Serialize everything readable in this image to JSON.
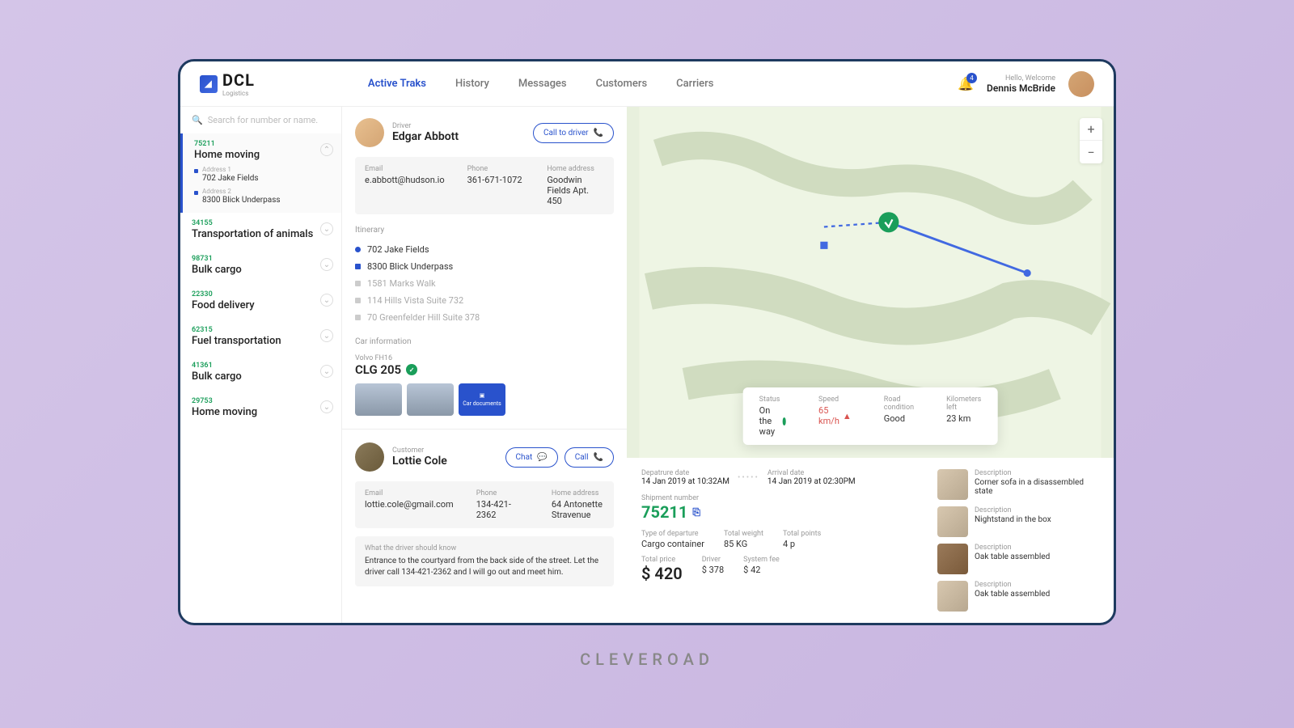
{
  "brand": {
    "name": "DCL",
    "sub": "Logistics"
  },
  "nav": [
    "Active Traks",
    "History",
    "Messages",
    "Customers",
    "Carriers"
  ],
  "nav_active": 0,
  "notif_count": "4",
  "user": {
    "welcome": "Hello, Welcome",
    "name": "Dennis McBride"
  },
  "search_placeholder": "Search for number or name.",
  "tracks": [
    {
      "id": "75211",
      "title": "Home moving",
      "selected": true,
      "addrs": [
        {
          "lbl": "Address 1",
          "val": "702 Jake Fields"
        },
        {
          "lbl": "Address 2",
          "val": "8300 Blick Underpass"
        }
      ]
    },
    {
      "id": "34155",
      "title": "Transportation of animals"
    },
    {
      "id": "98731",
      "title": "Bulk cargo"
    },
    {
      "id": "22330",
      "title": "Food delivery"
    },
    {
      "id": "62315",
      "title": "Fuel transportation"
    },
    {
      "id": "41361",
      "title": "Bulk cargo"
    },
    {
      "id": "29753",
      "title": "Home moving"
    }
  ],
  "driver": {
    "role": "Driver",
    "name": "Edgar Abbott",
    "call": "Call to driver",
    "email_lbl": "Email",
    "email": "e.abbott@hudson.io",
    "phone_lbl": "Phone",
    "phone": "361-671-1072",
    "home_lbl": "Home address",
    "home": "Goodwin Fields Apt. 450"
  },
  "itinerary_lbl": "Itinerary",
  "itinerary": [
    "702 Jake Fields",
    "8300 Blick Underpass",
    "1581 Marks Walk",
    "114 Hills Vista Suite 732",
    "70 Greenfelder Hill Suite 378"
  ],
  "car": {
    "section": "Car information",
    "model": "Volvo FH16",
    "plate": "CLG 205",
    "doc": "Car documents"
  },
  "customer": {
    "role": "Customer",
    "name": "Lottie Cole",
    "chat": "Chat",
    "call": "Call",
    "email_lbl": "Email",
    "email": "lottie.cole@gmail.com",
    "phone_lbl": "Phone",
    "phone": "134-421-2362",
    "home_lbl": "Home address",
    "home": "64 Antonette Stravenue"
  },
  "note": {
    "title": "What the driver should know",
    "text": "Entrance to the courtyard from the back side of the street. Let the driver call 134-421-2362 and I will go out and meet him."
  },
  "map_status": {
    "status_lbl": "Status",
    "status": "On the way",
    "speed_lbl": "Speed",
    "speed": "65 km/h",
    "road_lbl": "Road condition",
    "road": "Good",
    "km_lbl": "Kilometers left",
    "km": "23 km"
  },
  "shipment": {
    "dep_lbl": "Depatrure date",
    "dep": "14 Jan 2019 at 10:32AM",
    "arr_lbl": "Arrival date",
    "arr": "14 Jan 2019 at 02:30PM",
    "num_lbl": "Shipment number",
    "num": "75211",
    "type_lbl": "Type of departure",
    "type": "Cargo container",
    "weight_lbl": "Total weight",
    "weight": "85 KG",
    "points_lbl": "Total points",
    "points": "4 p",
    "price_lbl": "Total price",
    "price": "$ 420",
    "driver_lbl": "Driver",
    "driver_fee": "$ 378",
    "sys_lbl": "System fee",
    "sys_fee": "$ 42"
  },
  "items": [
    {
      "lbl": "Description",
      "desc": "Corner sofa in a disassembled state"
    },
    {
      "lbl": "Description",
      "desc": "Nightstand in the box"
    },
    {
      "lbl": "Description",
      "desc": "Oak table assembled"
    },
    {
      "lbl": "Description",
      "desc": "Oak table assembled"
    }
  ],
  "footer": "CLEVEROAD"
}
